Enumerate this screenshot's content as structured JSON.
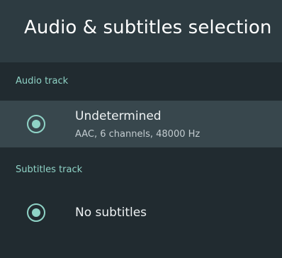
{
  "header": {
    "title": "Audio & subtitles selection"
  },
  "audio": {
    "section_label": "Audio track",
    "options": [
      {
        "label": "Undetermined",
        "detail": "AAC, 6 channels, 48000 Hz",
        "selected": true
      }
    ]
  },
  "subtitles": {
    "section_label": "Subtitles track",
    "options": [
      {
        "label": "No subtitles",
        "selected": true
      }
    ]
  },
  "colors": {
    "accent": "#8fd3c6",
    "header_bg": "#2d3b41",
    "panel_bg": "#212b30",
    "selected_row_bg": "#38474d"
  }
}
